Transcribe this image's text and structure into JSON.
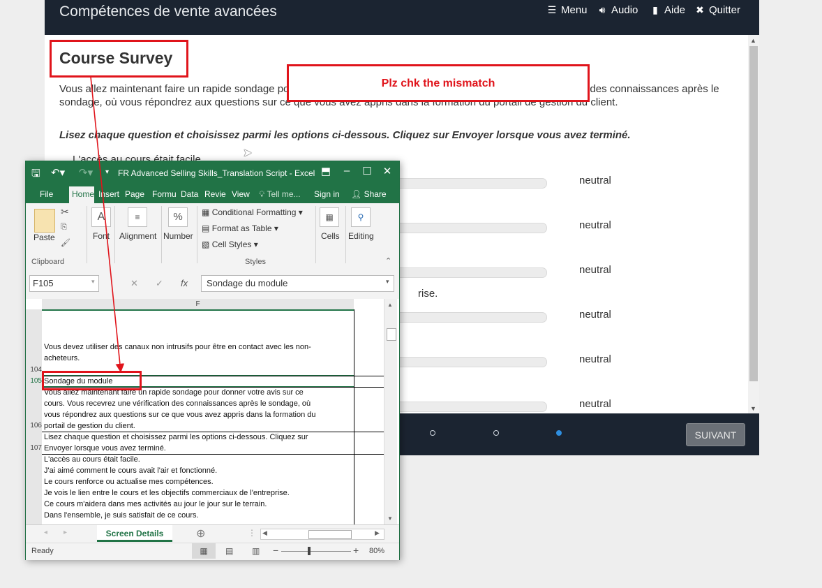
{
  "player": {
    "course_title": "Compétences de vente avancées",
    "nav": {
      "menu": "Menu",
      "audio": "Audio",
      "help": "Aide",
      "quit": "Quitter"
    },
    "survey_title": "Course Survey",
    "intro": "Vous allez maintenant faire un rapide sondage pour donner votre avis sur ce cours. Vous recevrez une vérification des connaissances après le sondage, où vous répondrez aux questions sur ce que vous avez appris dans la formation du portail de gestion du client.",
    "instructions": "Lisez chaque question et choisissez parmi les options ci-dessous. Cliquez sur Envoyer lorsque vous avez terminé.",
    "question_1": "L'accès au cours était facile.",
    "question_fragment": "rise.",
    "rating_labels": [
      "neutral",
      "neutral",
      "neutral",
      "neutral",
      "neutral",
      "neutral"
    ],
    "next_button": "SUIVANT",
    "progress_dots": 3,
    "active_dot": 3
  },
  "annotation": {
    "note": "Plz chk the mismatch"
  },
  "excel": {
    "window_title": "FR Advanced Selling Skills_Translation Script - Excel",
    "tabs": [
      "File",
      "Home",
      "Insert",
      "Page",
      "Formu",
      "Data",
      "Revie",
      "View"
    ],
    "tell_me": "Tell me...",
    "sign_in": "Sign in",
    "share": "Share",
    "ribbon": {
      "paste": "Paste",
      "clipboard": "Clipboard",
      "font": "Font",
      "alignment": "Alignment",
      "number": "Number",
      "conditional_formatting": "Conditional Formatting",
      "format_as_table": "Format as Table",
      "cell_styles": "Cell Styles",
      "styles": "Styles",
      "cells": "Cells",
      "editing": "Editing"
    },
    "name_box": "F105",
    "formula_value": "Sondage du module",
    "column_header": "F",
    "rows": [
      {
        "num": "104",
        "text": "Vous devez utiliser des canaux non intrusifs pour être en contact avec les non-\nacheteurs."
      },
      {
        "num": "105",
        "text": "Sondage du module"
      },
      {
        "num": "106",
        "text": "Vous allez maintenant faire un rapide sondage pour donner votre avis sur ce\ncours. Vous recevrez une vérification des connaissances après le sondage, où\nvous répondrez aux questions sur ce que vous avez appris dans la formation du\nportail de gestion du client."
      },
      {
        "num": "107",
        "text": "Lisez chaque question et choisissez parmi les options ci-dessous. Cliquez sur\nEnvoyer lorsque vous avez terminé."
      },
      {
        "num": "",
        "text": "L'accès au cours était facile.\nJ'ai aimé comment le cours avait l'air et fonctionné.\nLe cours renforce ou actualise mes compétences.\nJe vois le lien entre le cours et les objectifs commerciaux de l'entreprise.\nCe cours m'aidera dans mes activités au jour le jour sur le terrain.\nDans l'ensemble, je suis satisfait de ce cours."
      }
    ],
    "sheet_tab": "Screen Details",
    "status": "Ready",
    "zoom": "80%"
  },
  "colors": {
    "player_bar": "#1b2431",
    "excel_green": "#217346",
    "annotation_red": "#e0141b",
    "active_dot": "#2f8fe0"
  }
}
